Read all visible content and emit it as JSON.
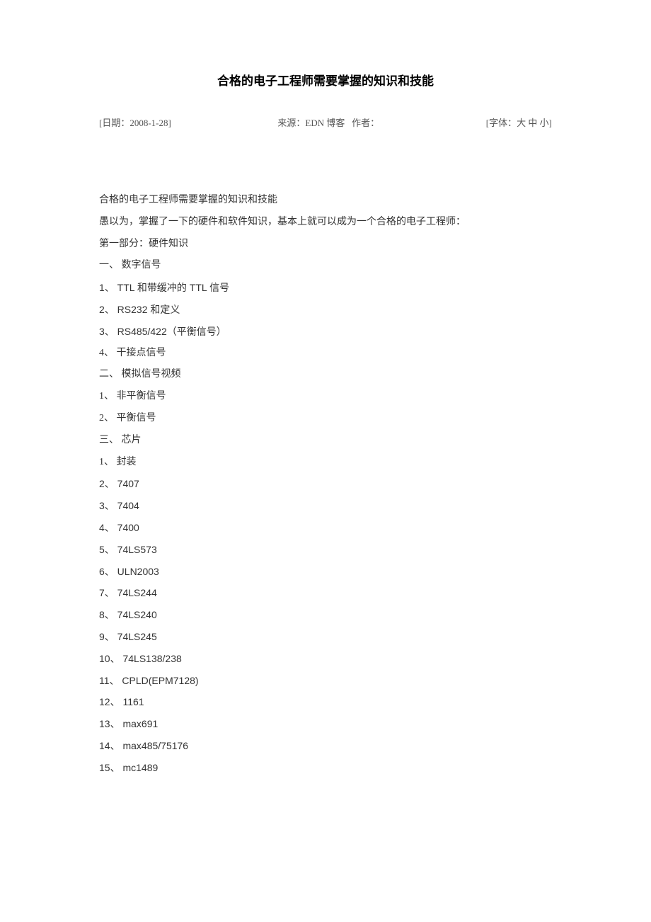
{
  "title": "合格的电子工程师需要掌握的知识和技能",
  "meta": {
    "date_label": "[日期：2008-1-28]",
    "source_label": "来源：EDN 博客",
    "author_label": "作者：",
    "font_label": "[字体：",
    "font_large": "大",
    "font_medium": "中",
    "font_small": "小",
    "font_close": "]"
  },
  "content": {
    "lines": [
      "合格的电子工程师需要掌握的知识和技能",
      "愚以为，掌握了一下的硬件和软件知识，基本上就可以成为一个合格的电子工程师：",
      "第一部分：硬件知识",
      "一、 数字信号",
      "1、 TTL 和带缓冲的 TTL 信号",
      "2、 RS232 和定义",
      "3、 RS485/422（平衡信号）",
      "4、 干接点信号",
      "二、 模拟信号视频",
      "1、 非平衡信号",
      "2、 平衡信号",
      "三、 芯片",
      "1、 封装",
      "2、 7407",
      "3、 7404",
      "4、 7400",
      "5、 74LS573",
      "6、 ULN2003",
      "7、 74LS244",
      "8、 74LS240",
      "9、 74LS245",
      "10、 74LS138/238",
      "11、 CPLD(EPM7128)",
      "12、 1161",
      "13、 max691",
      "14、 max485/75176",
      "15、 mc1489"
    ]
  }
}
